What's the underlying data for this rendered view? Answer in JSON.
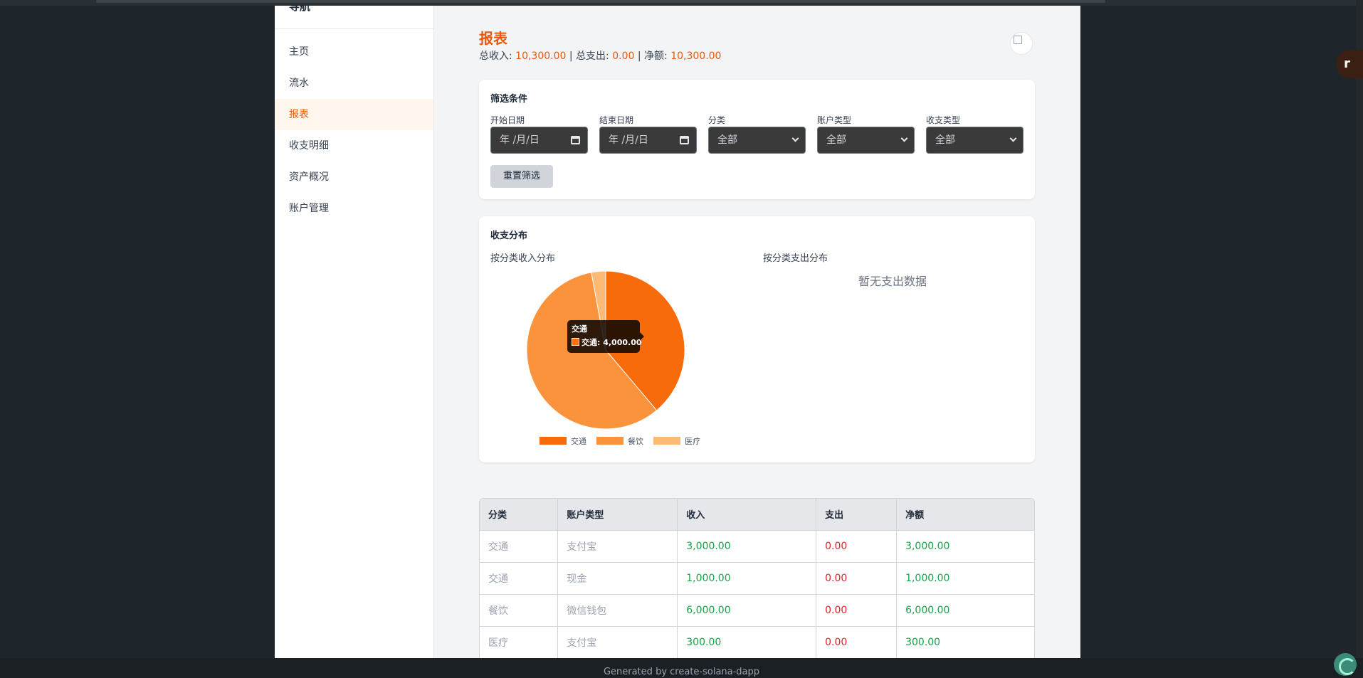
{
  "sidebar": {
    "title": "导航",
    "items": [
      {
        "label": "主页"
      },
      {
        "label": "流水"
      },
      {
        "label": "报表"
      },
      {
        "label": "收支明细"
      },
      {
        "label": "资产概况"
      },
      {
        "label": "账户管理"
      }
    ],
    "active_index": 2
  },
  "header": {
    "title": "报表",
    "income_label": "总收入:",
    "income_value": "10,300.00",
    "expense_label": "总支出:",
    "expense_value": "0.00",
    "net_label": "净额:",
    "net_value": "10,300.00",
    "separator": "|"
  },
  "filters": {
    "title": "筛选条件",
    "start_date": {
      "label": "开始日期",
      "placeholder": "年 /月/日"
    },
    "end_date": {
      "label": "结束日期",
      "placeholder": "年 /月/日"
    },
    "category": {
      "label": "分类",
      "value": "全部"
    },
    "account_type": {
      "label": "账户类型",
      "value": "全部"
    },
    "flow_type": {
      "label": "收支类型",
      "value": "全部"
    },
    "reset_label": "重置筛选"
  },
  "distribution": {
    "title": "收支分布",
    "income_title": "按分类收入分布",
    "expense_title": "按分类支出分布",
    "expense_empty": "暂无支出数据",
    "tooltip": {
      "title": "交通",
      "row": "交通: 4,000.00"
    }
  },
  "chart_data": {
    "type": "pie",
    "title": "",
    "categories": [
      "交通",
      "餐饮",
      "医疗"
    ],
    "values": [
      4000,
      6000,
      300
    ],
    "colors": [
      "#f76b0a",
      "#fb923c",
      "#fdba74"
    ],
    "legend": "bottom"
  },
  "table": {
    "columns": [
      "分类",
      "账户类型",
      "收入",
      "支出",
      "净额"
    ],
    "rows": [
      {
        "category": "交通",
        "account": "支付宝",
        "income": "3,000.00",
        "expense": "0.00",
        "net": "3,000.00"
      },
      {
        "category": "交通",
        "account": "现金",
        "income": "1,000.00",
        "expense": "0.00",
        "net": "1,000.00"
      },
      {
        "category": "餐饮",
        "account": "微信钱包",
        "income": "6,000.00",
        "expense": "0.00",
        "net": "6,000.00"
      },
      {
        "category": "医疗",
        "account": "支付宝",
        "income": "300.00",
        "expense": "0.00",
        "net": "300.00"
      }
    ]
  },
  "footer": {
    "text": "Generated by create-solana-dapp"
  },
  "fab": {
    "label": "r"
  },
  "icons": {
    "date": "calendar-icon",
    "select": "chevron-down-icon",
    "avatar": "broken-image-icon",
    "corner": "solana-logo-icon"
  }
}
